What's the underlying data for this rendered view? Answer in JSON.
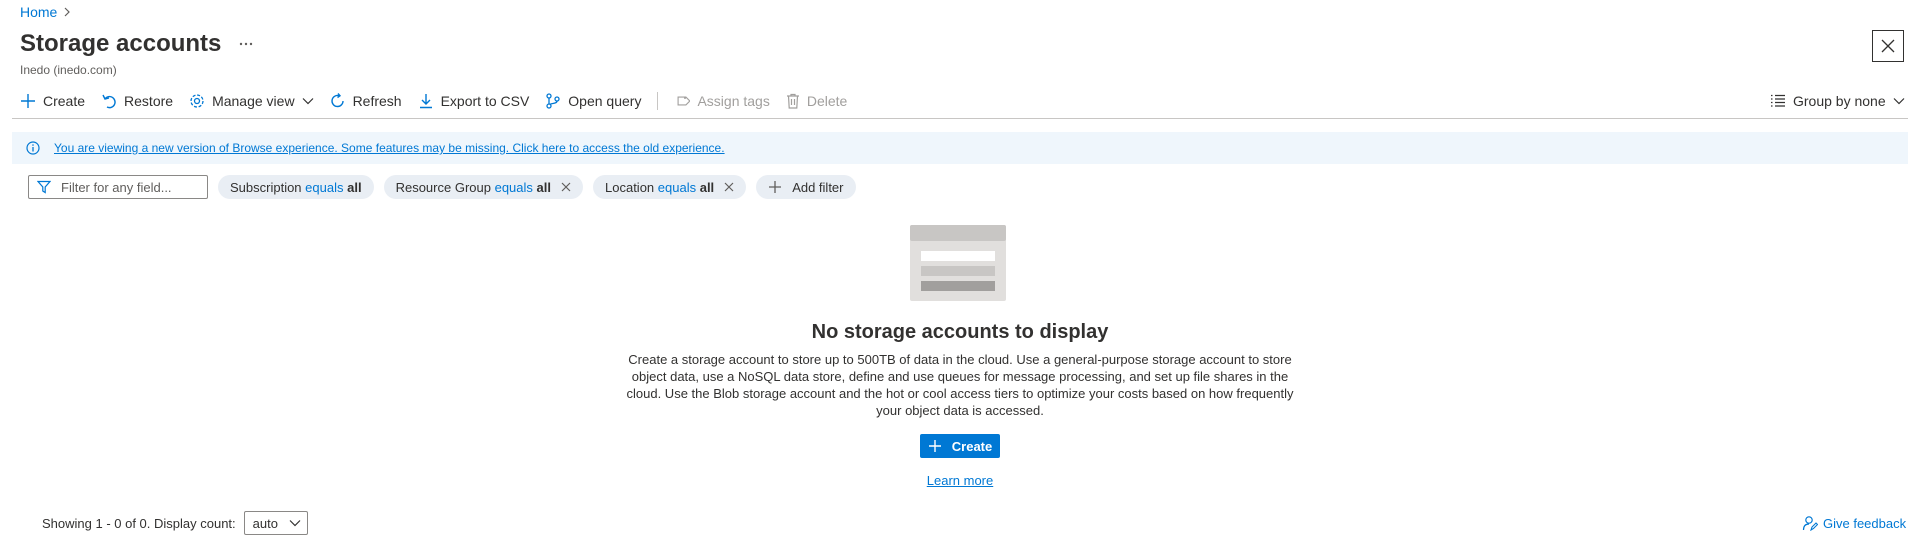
{
  "breadcrumb": {
    "home": "Home",
    "separator_icon": "chevron-right-icon"
  },
  "header": {
    "title": "Storage accounts",
    "more_label": "···",
    "subtitle": "Inedo (inedo.com)",
    "close_icon": "close-icon"
  },
  "toolbar": {
    "items": [
      {
        "label": "Create",
        "icon": "plus-icon",
        "disabled": false
      },
      {
        "label": "Restore",
        "icon": "undo-icon",
        "disabled": false
      },
      {
        "label": "Manage view",
        "icon": "gear-icon",
        "disabled": false
      },
      {
        "label": "Refresh",
        "icon": "refresh-icon",
        "disabled": false
      },
      {
        "label": "Export to CSV",
        "icon": "download-icon",
        "disabled": false
      },
      {
        "label": "Open query",
        "icon": "query-icon",
        "disabled": false
      },
      {
        "label": "Assign tags",
        "icon": "tag-icon",
        "disabled": true
      },
      {
        "label": "Delete",
        "icon": "trash-icon",
        "disabled": true
      }
    ],
    "group_by": "Group by none"
  },
  "banner": {
    "text": "You are viewing a new version of Browse experience. Some features may be missing. Click here to access the old experience."
  },
  "filters": {
    "search_placeholder": "Filter for any field...",
    "search_value": "",
    "pills": [
      {
        "field": "Subscription",
        "op": "equals",
        "value": "all",
        "removable": false
      },
      {
        "field": "Resource Group",
        "op": "equals",
        "value": "all",
        "removable": true
      },
      {
        "field": "Location",
        "op": "equals",
        "value": "all",
        "removable": true
      }
    ],
    "add_filter": "Add filter"
  },
  "empty_state": {
    "title": "No storage accounts to display",
    "description": "Create a storage account to store up to 500TB of data in the cloud. Use a general-purpose storage account to store object data, use a NoSQL data store, define and use queues for message processing, and set up file shares in the cloud. Use the Blob storage account and the hot or cool access tiers to optimize your costs based on how frequently your object data is accessed.",
    "create_label": "Create",
    "learn_more": "Learn more"
  },
  "footer": {
    "showing": "Showing 1 - 0 of 0. Display count:",
    "display_count": "auto",
    "feedback": "Give feedback"
  },
  "colors": {
    "accent": "#0078d4",
    "banner_bg": "#eff6fc",
    "pill_bg": "#e9eef4"
  }
}
